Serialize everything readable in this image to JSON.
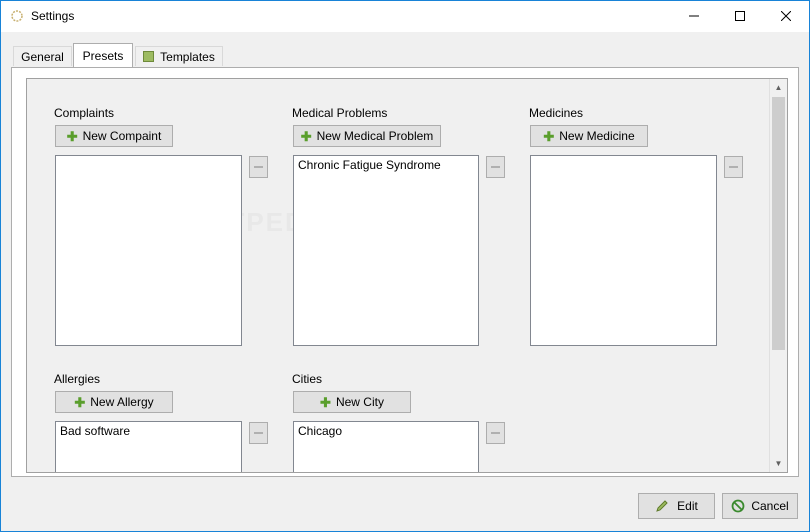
{
  "window": {
    "title": "Settings"
  },
  "tabs": [
    {
      "label": "General"
    },
    {
      "label": "Presets"
    },
    {
      "label": "Templates"
    }
  ],
  "sections": {
    "complaints": {
      "label": "Complaints",
      "button": "New Compaint",
      "items": []
    },
    "medical_problems": {
      "label": "Medical Problems",
      "button": "New Medical Problem",
      "items": [
        "Chronic Fatigue Syndrome"
      ]
    },
    "medicines": {
      "label": "Medicines",
      "button": "New Medicine",
      "items": []
    },
    "allergies": {
      "label": "Allergies",
      "button": "New Allergy",
      "items": [
        "Bad software"
      ]
    },
    "cities": {
      "label": "Cities",
      "button": "New City",
      "items": [
        "Chicago"
      ]
    }
  },
  "footer": {
    "edit": "Edit",
    "cancel": "Cancel"
  },
  "watermark": "SOFTPEDIA",
  "colors": {
    "window_border": "#1883d7",
    "plus_icon": "#5a9e2c",
    "edit_icon": "#7a9a2e",
    "cancel_icon": "#3a8a2e"
  }
}
